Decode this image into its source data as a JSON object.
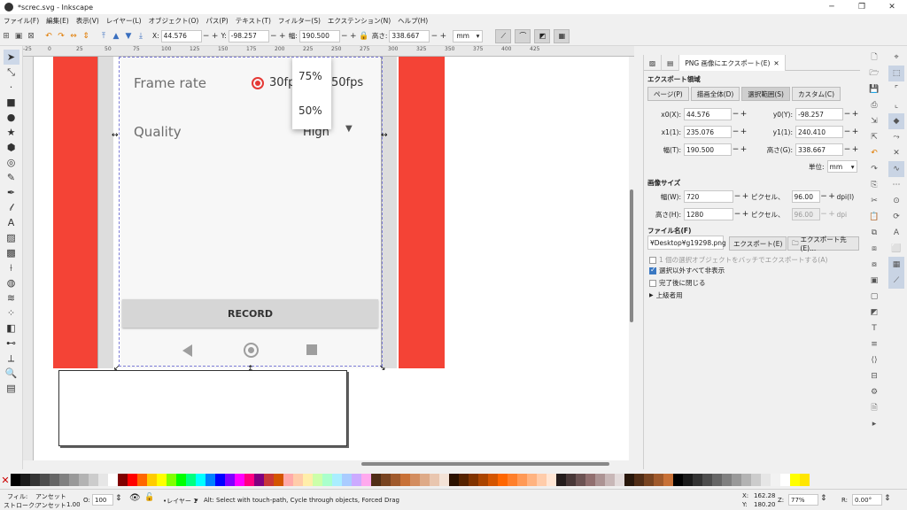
{
  "window": {
    "title": "*screc.svg - Inkscape",
    "controls": [
      "─",
      "❐",
      "✕"
    ]
  },
  "menu": [
    "ファイル(F)",
    "編集(E)",
    "表示(V)",
    "レイヤー(L)",
    "オブジェクト(O)",
    "パス(P)",
    "テキスト(T)",
    "フィルター(S)",
    "エクステンション(N)",
    "ヘルプ(H)"
  ],
  "toolbar": {
    "x_label": "X:",
    "x_value": "44.576",
    "y_label": "Y:",
    "y_value": "-98.257",
    "w_label": "幅:",
    "w_value": "190.500",
    "h_label": "高さ:",
    "h_value": "338.667",
    "unit": "mm"
  },
  "ruler_ticks": [
    "-25",
    "0",
    "25",
    "50",
    "75",
    "100",
    "125",
    "150",
    "175",
    "200",
    "225",
    "250",
    "275",
    "300",
    "325",
    "350",
    "375",
    "400",
    "425"
  ],
  "canvas": {
    "frame_rate_label": "Frame rate",
    "frame_rate_option1": "30fp",
    "frame_rate_option2": "50fps",
    "quality_label": "Quality",
    "quality_value": "High",
    "dropdown_options": [
      "75%",
      "50%"
    ],
    "record_button": "RECORD"
  },
  "dialog": {
    "tabs": [
      "PNG 画像にエクスポート(E)"
    ],
    "export_area_title": "エクスポート領域",
    "area_buttons": [
      "ページ(P)",
      "描画全体(D)",
      "選択範囲(S)",
      "カスタム(C)"
    ],
    "x0_label": "x0(X):",
    "x0_value": "44.576",
    "y0_label": "y0(Y):",
    "y0_value": "-98.257",
    "x1_label": "x1(1):",
    "x1_value": "235.076",
    "y1_label": "y1(1):",
    "y1_value": "240.410",
    "width_label": "幅(T):",
    "width_value": "190.500",
    "height_label": "高さ(G):",
    "height_value": "338.667",
    "unit_label": "単位:",
    "unit_value": "mm",
    "image_size_title": "画像サイズ",
    "img_w_label": "幅(W):",
    "img_w_value": "720",
    "img_h_label": "高さ(H):",
    "img_h_value": "1280",
    "pixel_label": "ピクセル、",
    "dpi_value": "96.00",
    "dpi_label": "dpi(I)",
    "dpi2_value": "96.00",
    "dpi2_label": "dpi",
    "filename_title": "ファイル名(F)",
    "filename_value": "¥Desktop¥g19298.png",
    "export_button": "エクスポート(E)",
    "export_as_button": "エクスポート先(E)...",
    "batch_checkbox": "1 個の選択オブジェクトをバッチでエクスポートする(A)",
    "hide_checkbox": "選択以外すべて非表示",
    "close_checkbox": "完了後に閉じる",
    "advanced": "上級者用"
  },
  "status": {
    "fill_label": "フィル:",
    "fill_value": "アンセット",
    "stroke_label": "ストローク:",
    "stroke_value": "アンセット",
    "stroke_width": "1.00",
    "opacity_label": "O:",
    "opacity_value": "100",
    "layer": "•レイヤー 1",
    "message": "Alt: Select with touch-path, Cycle through objects, Forced Drag",
    "x_label": "X:",
    "x_value": "162.28",
    "y_label": "Y:",
    "y_value": "180.20",
    "zoom_label": "Z:",
    "zoom_value": "77%",
    "rotation_label": "R:",
    "rotation_value": "0.00°"
  },
  "colors": {
    "accent_red": "#f44336",
    "radio_red": "#e53935",
    "palette": [
      "#000000",
      "#1a1a1a",
      "#333333",
      "#4d4d4d",
      "#666666",
      "#808080",
      "#999999",
      "#b3b3b3",
      "#cccccc",
      "#e6e6e6",
      "#ffffff",
      "#800000",
      "#ff0000",
      "#ff6600",
      "#ffcc00",
      "#ffff00",
      "#80ff00",
      "#00ff00",
      "#00ff80",
      "#00ffff",
      "#0080ff",
      "#0000ff",
      "#8000ff",
      "#ff00ff",
      "#ff0080",
      "#800080",
      "#c83737",
      "#d45500",
      "#ffaaaa",
      "#ffccaa",
      "#ffeeaa",
      "#ccffaa",
      "#aaffcc",
      "#aaeeff",
      "#aaccff",
      "#ccaaff",
      "#ffaaee",
      "#502d16",
      "#784421",
      "#a05a2c",
      "#c87137",
      "#d38d5f",
      "#deaa87",
      "#e9c6af",
      "#f4e3d7",
      "#2b1100",
      "#552200",
      "#803300",
      "#aa4400",
      "#d45500",
      "#ff6600",
      "#ff7f2a",
      "#ff9955",
      "#ffb380",
      "#ffccaa",
      "#ffe6d5",
      "#241c1c",
      "#483737",
      "#6c5353",
      "#916f6f",
      "#ac9393",
      "#c8b7b7",
      "#e3dbdb",
      "#28170b",
      "#502d16",
      "#784421",
      "#a05a2c",
      "#c87137",
      "#000000",
      "#1a1a1a",
      "#333333",
      "#4d4d4d",
      "#666666",
      "#808080",
      "#999999",
      "#b3b3b3",
      "#cccccc",
      "#e6e6e6",
      "#f2f2f2",
      "#ffffff",
      "#ffff00",
      "#ffe600"
    ]
  }
}
